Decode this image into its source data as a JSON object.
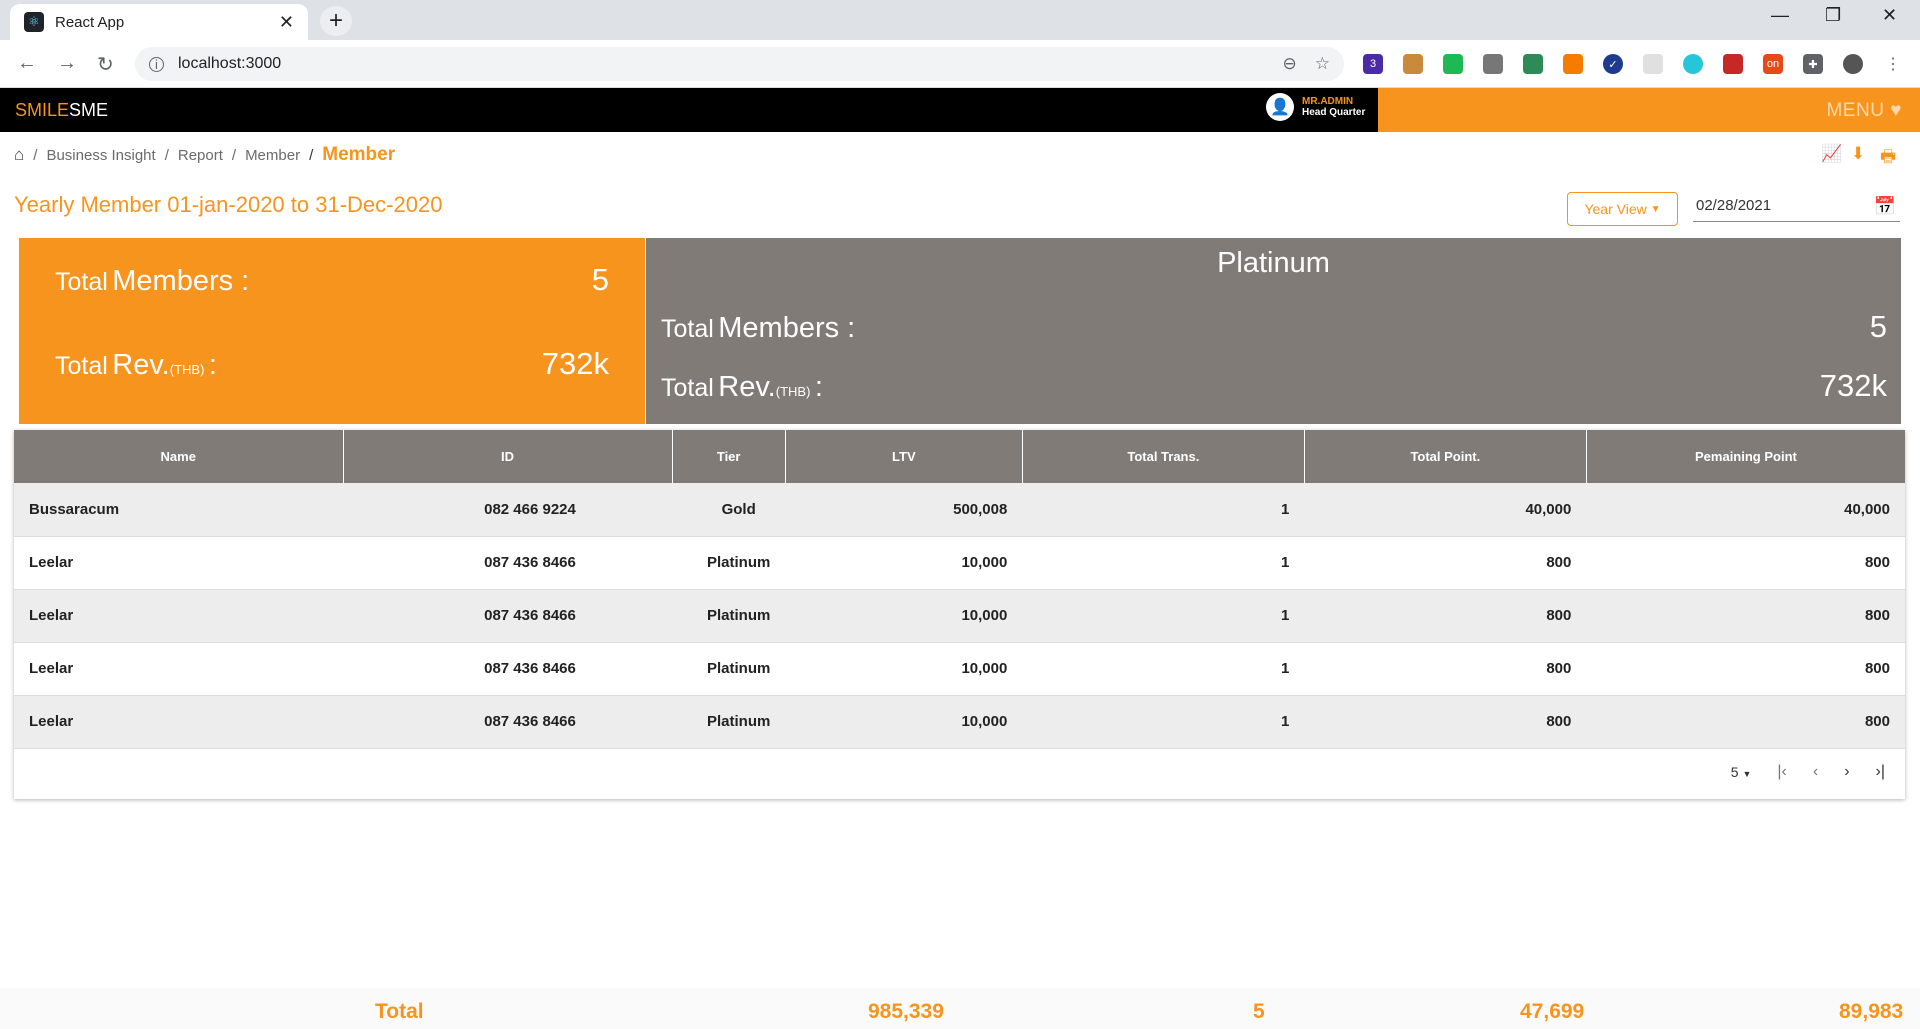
{
  "browser": {
    "tab_title": "React App",
    "url": "localhost:3000",
    "ext_badge_count": "3",
    "ext_on_label": "on"
  },
  "app": {
    "logo_part1": "SMILE",
    "logo_part2": "SME",
    "user_name": "MR.ADMIN",
    "user_branch": "Head Quarter",
    "menu_label": "MENU"
  },
  "breadcrumb": {
    "items": [
      "Business Insight",
      "Report",
      "Member"
    ],
    "current": "Member"
  },
  "page": {
    "title": "Yearly Member 01-jan-2020 to 31-Dec-2020",
    "view_button": "Year View",
    "date_value": "02/28/2021"
  },
  "summary": {
    "total_label_small": "Total",
    "members_label": "Members :",
    "rev_label": "Rev.",
    "thb_label": "(THB)",
    "colon": ":",
    "all": {
      "total_members": "5",
      "total_rev": "732k"
    },
    "platinum": {
      "title": "Platinum",
      "total_members": "5",
      "total_rev": "732k"
    }
  },
  "table": {
    "headers": [
      "Name",
      "ID",
      "Tier",
      "LTV",
      "Total Trans.",
      "Total Point.",
      "Pemaining Point"
    ],
    "rows": [
      [
        "Bussaracum",
        "082 466 9224",
        "Gold",
        "500,008",
        "1",
        "40,000",
        "40,000"
      ],
      [
        "Leelar",
        "087 436 8466",
        "Platinum",
        "10,000",
        "1",
        "800",
        "800"
      ],
      [
        "Leelar",
        "087 436 8466",
        "Platinum",
        "10,000",
        "1",
        "800",
        "800"
      ],
      [
        "Leelar",
        "087 436 8466",
        "Platinum",
        "10,000",
        "1",
        "800",
        "800"
      ],
      [
        "Leelar",
        "087 436 8466",
        "Platinum",
        "10,000",
        "1",
        "800",
        "800"
      ]
    ],
    "rows_per_page": "5"
  },
  "totals": {
    "label": "Total",
    "ltv": "985,339",
    "trans": "5",
    "points": "47,699",
    "remaining": "89,983"
  },
  "colors": {
    "accent": "#f7941d",
    "gray_panel": "#807b77",
    "header_black": "#000000"
  }
}
